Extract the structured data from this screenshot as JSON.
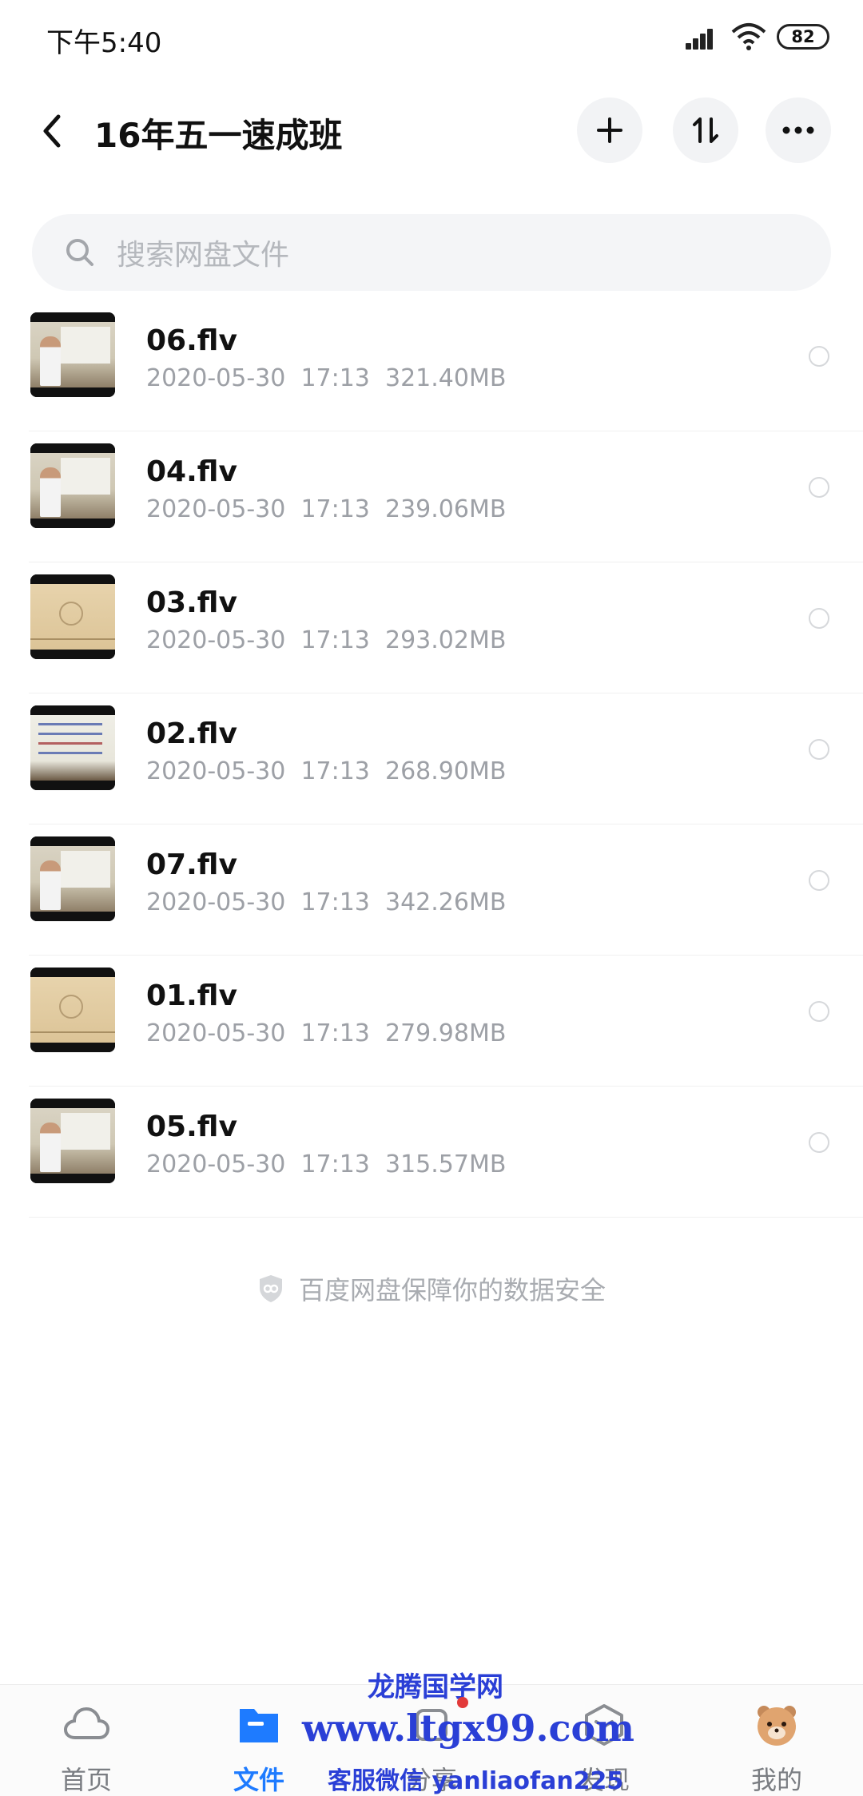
{
  "status_bar": {
    "time": "下午5:40",
    "battery": "82",
    "icons": [
      "signal-icon",
      "wifi-icon",
      "battery-icon"
    ]
  },
  "header": {
    "title": "16年五一速成班",
    "icons": [
      "back-arrow-icon",
      "plus-icon",
      "sort-icon",
      "more-dots-icon"
    ]
  },
  "search": {
    "placeholder": "搜索网盘文件"
  },
  "files": [
    {
      "name": "06.flv",
      "date": "2020-05-30",
      "time": "17:13",
      "size": "321.40MB",
      "thumb": "room"
    },
    {
      "name": "04.flv",
      "date": "2020-05-30",
      "time": "17:13",
      "size": "239.06MB",
      "thumb": "room"
    },
    {
      "name": "03.flv",
      "date": "2020-05-30",
      "time": "17:13",
      "size": "293.02MB",
      "thumb": "paper"
    },
    {
      "name": "02.flv",
      "date": "2020-05-30",
      "time": "17:13",
      "size": "268.90MB",
      "thumb": "board"
    },
    {
      "name": "07.flv",
      "date": "2020-05-30",
      "time": "17:13",
      "size": "342.26MB",
      "thumb": "room"
    },
    {
      "name": "01.flv",
      "date": "2020-05-30",
      "time": "17:13",
      "size": "279.98MB",
      "thumb": "paper"
    },
    {
      "name": "05.flv",
      "date": "2020-05-30",
      "time": "17:13",
      "size": "315.57MB",
      "thumb": "room"
    }
  ],
  "security_note": "百度网盘保障你的数据安全",
  "bottom_nav": [
    {
      "label": "首页",
      "icon": "cloud-icon",
      "active": false
    },
    {
      "label": "文件",
      "icon": "folder-icon",
      "active": true
    },
    {
      "label": "分享",
      "icon": "share-icon",
      "active": false
    },
    {
      "label": "发现",
      "icon": "discover-icon",
      "active": false
    },
    {
      "label": "我的",
      "icon": "avatar-icon",
      "active": false
    }
  ],
  "watermark": {
    "line1": "龙腾国学网",
    "line2": "www.ltgx99.com",
    "line3": "客服微信 yanliaofan225"
  },
  "colors": {
    "accent": "#1e7bff",
    "watermark": "#2a3fd6",
    "meta_text": "#9da0a6"
  }
}
